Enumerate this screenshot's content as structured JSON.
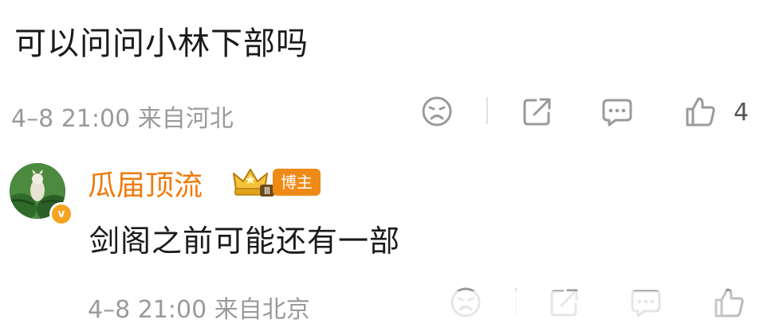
{
  "comment": {
    "text": "可以问问小林下部吗",
    "meta": "4–8 21:00  来自河北",
    "like_count": "4",
    "icons": [
      "dislike-face-icon",
      "share-icon",
      "comment-icon",
      "like-thumb-icon"
    ]
  },
  "reply": {
    "author": "瓜届顶流",
    "crown_level": "Ⅲ",
    "role_badge": "博主",
    "verified_mark": "v",
    "text": "剑阁之前可能还有一部",
    "meta": "4–8 21:00  来自北京",
    "icons": [
      "dislike-face-icon",
      "share-icon",
      "comment-icon",
      "like-thumb-icon"
    ]
  },
  "colors": {
    "author": "#f07a0c",
    "badge": "#f08a16",
    "meta": "#9a9a9a",
    "icon": "#9a9a9a"
  }
}
